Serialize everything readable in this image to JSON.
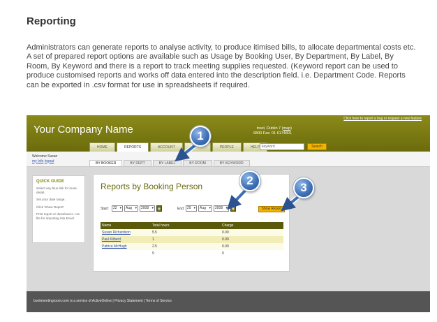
{
  "doc": {
    "title": "Reporting",
    "paragraph": "Administrators can generate reports to analyse activity, to produce itimised bills, to allocate departmental costs etc. A set of prepared report options are available such as Usage by Booking User, By Department, By Label, By Room, By Keyword and  there is a report to track meeting supplies requested. (Keyword report can be used to produce customised reports and works off data entered into the description field. i.e. Department Code. Reports can be exported in .csv format for use in spreadsheets if required."
  },
  "app": {
    "company": "Your Company Name",
    "toplink": "Click here to report a bug or request a new feature",
    "address_line1": "treet, Dublin 7 (",
    "map_link": "map",
    "address_line1_end": ")",
    "address_line2": "6800 Fax: 01 6174801",
    "nav": [
      "HOME",
      "REPORTS",
      "ACCOUNT",
      "",
      "PEOPLE",
      "HELP"
    ],
    "nav_active": "REPORTS",
    "keyword_value": "keyword",
    "search_label": "Search",
    "welcome": "Welcome Susan",
    "my_info": "my Info",
    "logout": "logout",
    "subtabs": [
      "BY BOOKER",
      "BY DEPT",
      "BY LABEL",
      "BY ROOM",
      "BY KEYWORD"
    ],
    "subtab_active": "BY BOOKER",
    "quick_guide": {
      "title": "QUICK GUIDE",
      "items": [
        "Select any blue link for more detail.",
        "Set your date range.",
        "Click 'Show Report'",
        "Print report or download a .csv file for importing into Excel."
      ]
    },
    "panel_title": "Reports by Booking Person",
    "start_label": "Start:",
    "start": {
      "day": "22",
      "month": "Aug",
      "year": "2008"
    },
    "end_label": "End:",
    "end": {
      "day": "29",
      "month": "Aug",
      "year": "2008"
    },
    "show_report": "Show Report",
    "table": {
      "headers": [
        "Name",
        "Total hours",
        "Charge"
      ],
      "rows": [
        [
          "Susan Richardson",
          "5.5",
          "0.00"
        ],
        [
          "Paul Kilberd",
          "1",
          "0.00"
        ],
        [
          "Patrica McHugh",
          "2.5",
          "0.00"
        ]
      ],
      "total": [
        "",
        "9",
        "0"
      ]
    },
    "footer": "bookmeetingroom.com is a service of  ActiveOnline   |   Privacy Statement   |   Terms of Service"
  },
  "callouts": [
    "1",
    "2",
    "3"
  ],
  "colors": {
    "header_olive": "#7a7a14",
    "accent_yellow": "#f4b400",
    "callout_blue": "#3d6fb5"
  }
}
